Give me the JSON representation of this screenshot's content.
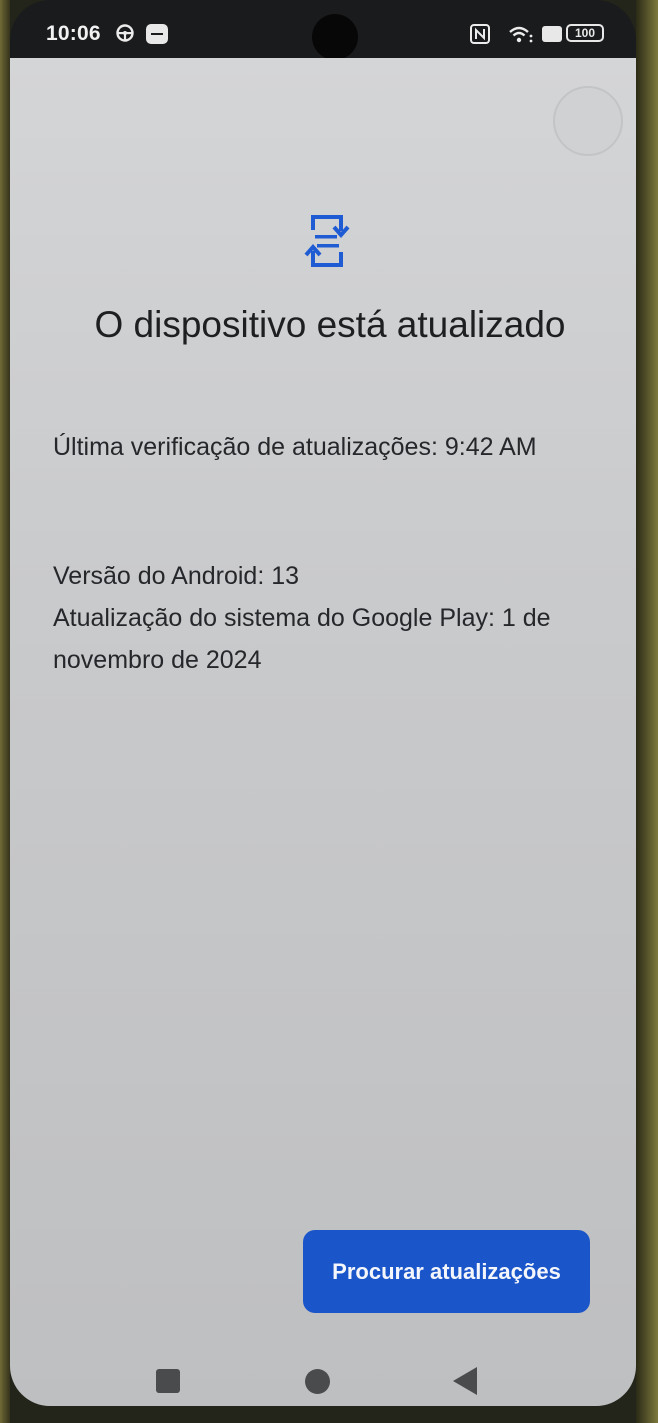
{
  "status_bar": {
    "time": "10:06",
    "battery": "100",
    "icons": [
      "steering-wheel-icon",
      "message-icon",
      "nfc-icon",
      "wifi-icon",
      "sim-icon",
      "battery-icon"
    ]
  },
  "page": {
    "icon": "system-update-icon",
    "title": "O dispositivo está atualizado",
    "last_check": "Última verificação de atualizações: 9:42 AM",
    "android_version": "Versão do Android: 13",
    "play_system_update": "Atualização do sistema do Google Play: 1 de novembro de 2024"
  },
  "actions": {
    "check_updates_label": "Procurar atualizações"
  },
  "navigation": {
    "icons": [
      "recents-icon",
      "home-icon",
      "back-icon"
    ]
  },
  "colors": {
    "accent": "#1a56c9",
    "icon": "#1f5bd3"
  }
}
